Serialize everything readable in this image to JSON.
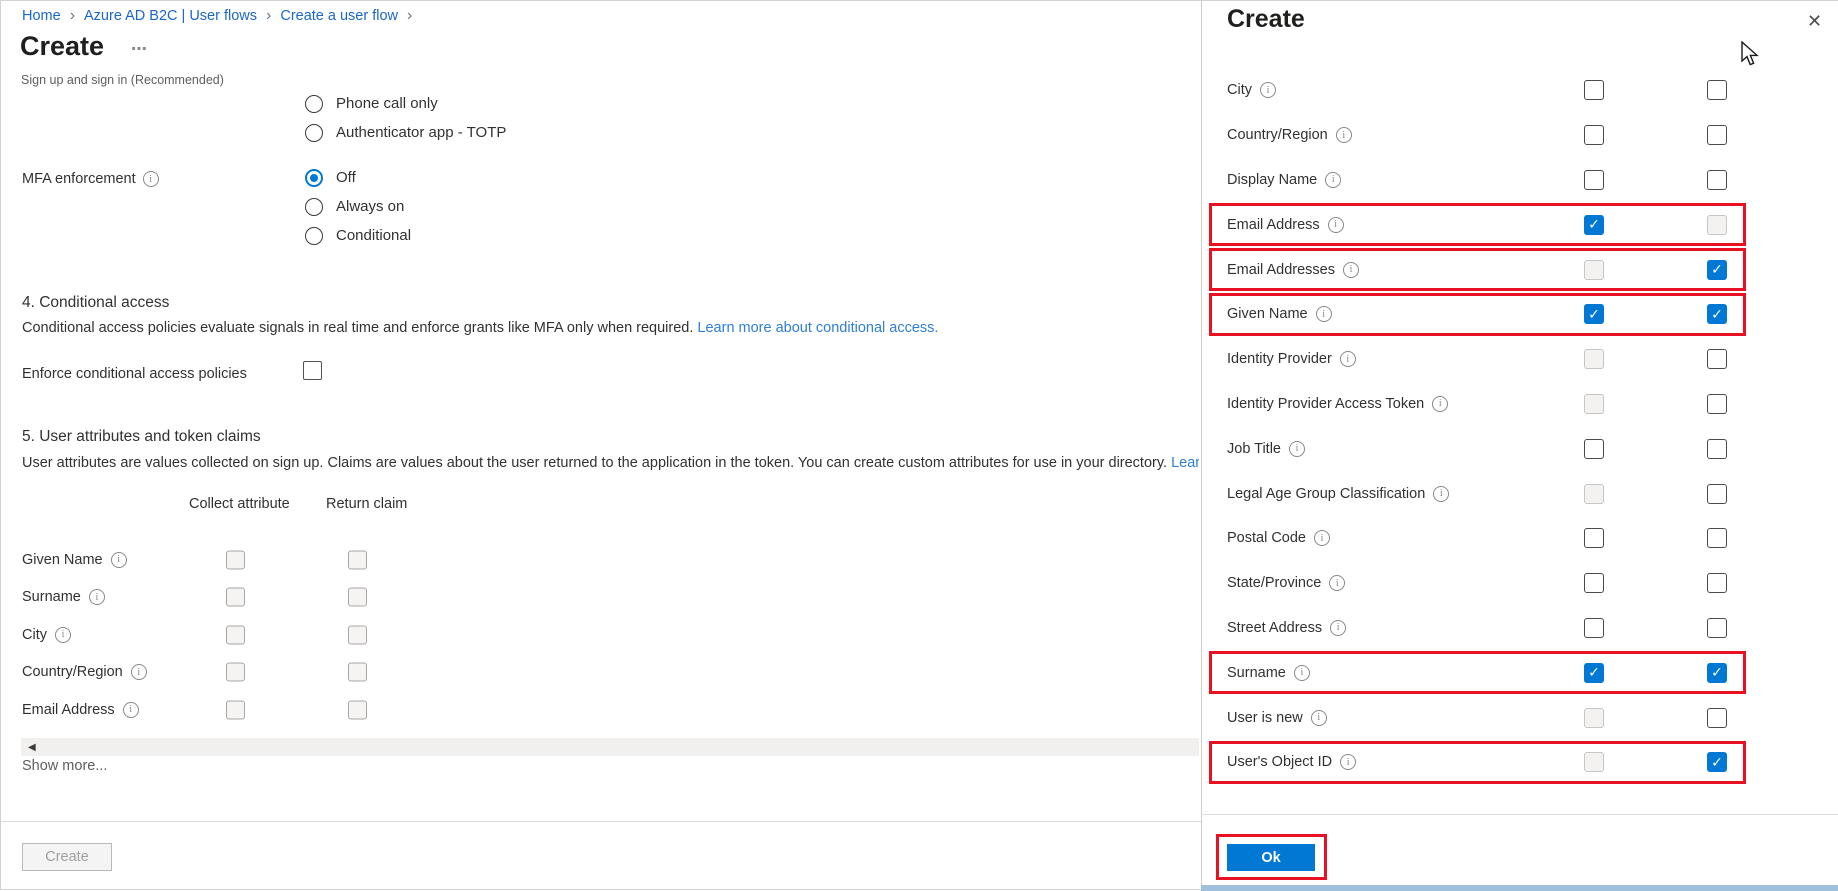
{
  "colors": {
    "accent": "#0078d4",
    "highlight_red": "#e81123",
    "breadcrumb_link": "#1b66c9",
    "inline_link": "#2f7ed7"
  },
  "breadcrumb": {
    "items": [
      {
        "label": "Home"
      },
      {
        "label": "Azure AD B2C | User flows"
      },
      {
        "label": "Create a user flow"
      }
    ]
  },
  "header": {
    "title": "Create",
    "menu_icon": "ellipsis-horizontal",
    "subtitle": "Sign up and sign in (Recommended)"
  },
  "mfa_methods": {
    "options": [
      {
        "label": "Phone call only",
        "state": "unselected"
      },
      {
        "label": "Authenticator app - TOTP",
        "state": "unselected"
      }
    ]
  },
  "mfa_enforcement": {
    "label": "MFA enforcement",
    "info_icon": "info-circle",
    "options": [
      {
        "label": "Off",
        "state": "selected"
      },
      {
        "label": "Always on",
        "state": "unselected"
      },
      {
        "label": "Conditional",
        "state": "unselected"
      }
    ]
  },
  "conditional_access": {
    "heading": "4. Conditional access",
    "description": "Conditional access policies evaluate signals in real time and enforce grants like MFA only when required.",
    "link": "Learn more about conditional access.",
    "enforce_label": "Enforce conditional access policies",
    "enforce_checkbox_state": "unchecked"
  },
  "user_attributes": {
    "heading": "5. User attributes and token claims",
    "description": "User attributes are values collected on sign up. Claims are values about the user returned to the application in the token. You can create custom attributes for use in your directory.",
    "link_truncated": "Learn",
    "columns": {
      "collect": "Collect attribute",
      "claim": "Return claim"
    },
    "rows": [
      {
        "label": "Given Name",
        "collect": "disabled",
        "claim": "disabled"
      },
      {
        "label": "Surname",
        "collect": "disabled",
        "claim": "disabled"
      },
      {
        "label": "City",
        "collect": "disabled",
        "claim": "disabled"
      },
      {
        "label": "Country/Region",
        "collect": "disabled",
        "claim": "disabled"
      },
      {
        "label": "Email Address",
        "collect": "disabled",
        "claim": "disabled"
      }
    ],
    "show_more": "Show more...",
    "scrollbar_arrow_icon": "triangle-left"
  },
  "footer": {
    "create_button": "Create"
  },
  "panel": {
    "title": "Create",
    "close_icon": "x-close",
    "rows": [
      {
        "label": "City",
        "collect": "unchecked",
        "claim": "unchecked",
        "highlighted": false
      },
      {
        "label": "Country/Region",
        "collect": "unchecked",
        "claim": "unchecked",
        "highlighted": false
      },
      {
        "label": "Display Name",
        "collect": "unchecked",
        "claim": "unchecked",
        "highlighted": false
      },
      {
        "label": "Email Address",
        "collect": "checked",
        "claim": "disabled",
        "highlighted": true
      },
      {
        "label": "Email Addresses",
        "collect": "disabled",
        "claim": "checked",
        "highlighted": true
      },
      {
        "label": "Given Name",
        "collect": "checked",
        "claim": "checked",
        "highlighted": true
      },
      {
        "label": "Identity Provider",
        "collect": "disabled",
        "claim": "unchecked",
        "highlighted": false
      },
      {
        "label": "Identity Provider Access Token",
        "collect": "disabled",
        "claim": "unchecked",
        "highlighted": false
      },
      {
        "label": "Job Title",
        "collect": "unchecked",
        "claim": "unchecked",
        "highlighted": false
      },
      {
        "label": "Legal Age Group Classification",
        "collect": "disabled",
        "claim": "unchecked",
        "highlighted": false
      },
      {
        "label": "Postal Code",
        "collect": "unchecked",
        "claim": "unchecked",
        "highlighted": false
      },
      {
        "label": "State/Province",
        "collect": "unchecked",
        "claim": "unchecked",
        "highlighted": false
      },
      {
        "label": "Street Address",
        "collect": "unchecked",
        "claim": "unchecked",
        "highlighted": false
      },
      {
        "label": "Surname",
        "collect": "checked",
        "claim": "checked",
        "highlighted": true
      },
      {
        "label": "User is new",
        "collect": "disabled",
        "claim": "unchecked",
        "highlighted": false
      },
      {
        "label": "User's Object ID",
        "collect": "disabled",
        "claim": "checked",
        "highlighted": true
      }
    ],
    "ok_button": "Ok"
  }
}
